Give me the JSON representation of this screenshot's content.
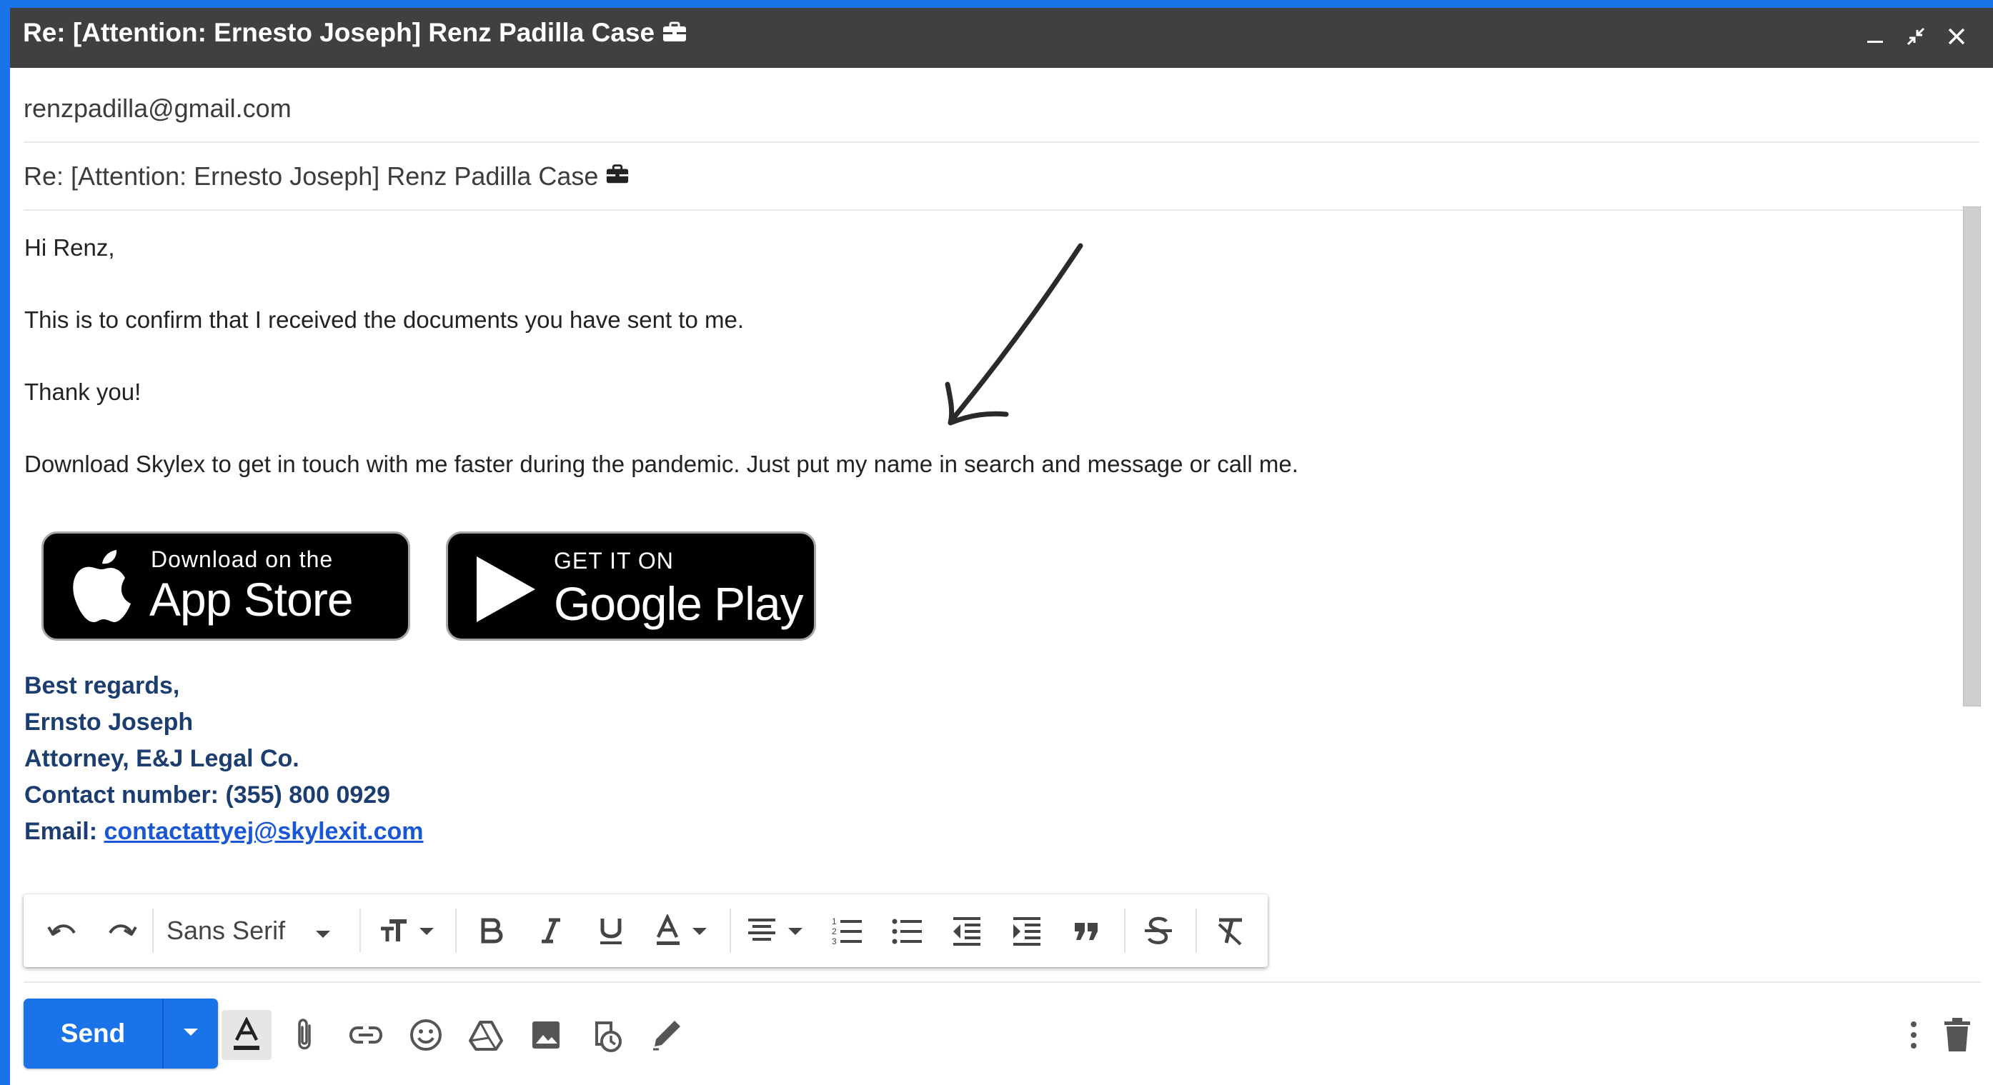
{
  "window": {
    "title": "Re: [Attention: Ernesto Joseph] Renz Padilla Case",
    "controls": [
      "minimize-icon",
      "exit-fullscreen-icon",
      "close-icon"
    ]
  },
  "recipients": "renzpadilla@gmail.com",
  "subject": "Re: [Attention: Ernesto Joseph] Renz Padilla Case",
  "body": {
    "greeting": "Hi Renz,",
    "line1": "This is to confirm that I received the documents you have sent to me.",
    "line2": "Thank you!",
    "line3": "Download Skylex to get in touch with me faster during the pandemic. Just put my name in search and message or call me."
  },
  "badges": {
    "appstore_small": "Download on the",
    "appstore_big": "App Store",
    "googleplay_small": "GET IT ON",
    "googleplay_big": "Google Play"
  },
  "signature": {
    "closing": "Best regards,",
    "name": "Ernsto Joseph",
    "title": "Attorney, E&J Legal Co.",
    "contact": "Contact number: (355) 800 0929",
    "email_label": "Email:",
    "email": "contactattyej@skylexit.com"
  },
  "format_toolbar": {
    "font": "Sans Serif",
    "tools": [
      "undo-icon",
      "redo-icon",
      "font-select",
      "text-size-icon",
      "bold-icon",
      "italic-icon",
      "underline-icon",
      "text-color-icon",
      "align-icon",
      "numbered-list-icon",
      "bulleted-list-icon",
      "indent-less-icon",
      "indent-more-icon",
      "quote-icon",
      "strikethrough-icon",
      "clear-formatting-icon"
    ]
  },
  "bottom_bar": {
    "send_label": "Send",
    "tools": [
      "formatting-options-icon",
      "attach-icon",
      "link-icon",
      "emoji-icon",
      "drive-icon",
      "photo-icon",
      "confidential-icon",
      "signature-icon",
      "more-options-icon",
      "discard-icon"
    ]
  },
  "colors": {
    "frame": "#1a73e8",
    "titlebar": "#404040",
    "send": "#1a73e8",
    "signature_text": "#1c3d70",
    "link": "#1a57d6"
  }
}
